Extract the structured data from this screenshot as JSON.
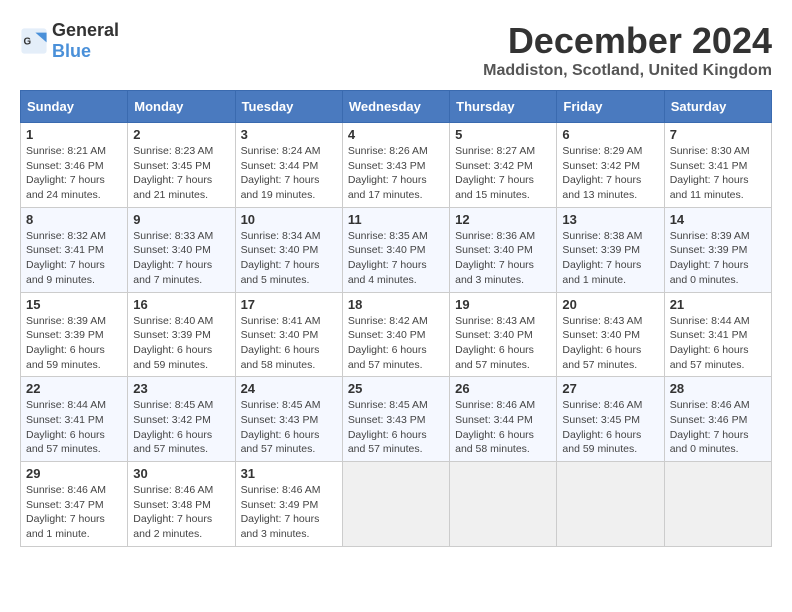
{
  "header": {
    "logo_general": "General",
    "logo_blue": "Blue",
    "month_title": "December 2024",
    "location": "Maddiston, Scotland, United Kingdom"
  },
  "days_of_week": [
    "Sunday",
    "Monday",
    "Tuesday",
    "Wednesday",
    "Thursday",
    "Friday",
    "Saturday"
  ],
  "weeks": [
    [
      {
        "day": "1",
        "sunrise": "Sunrise: 8:21 AM",
        "sunset": "Sunset: 3:46 PM",
        "daylight": "Daylight: 7 hours and 24 minutes."
      },
      {
        "day": "2",
        "sunrise": "Sunrise: 8:23 AM",
        "sunset": "Sunset: 3:45 PM",
        "daylight": "Daylight: 7 hours and 21 minutes."
      },
      {
        "day": "3",
        "sunrise": "Sunrise: 8:24 AM",
        "sunset": "Sunset: 3:44 PM",
        "daylight": "Daylight: 7 hours and 19 minutes."
      },
      {
        "day": "4",
        "sunrise": "Sunrise: 8:26 AM",
        "sunset": "Sunset: 3:43 PM",
        "daylight": "Daylight: 7 hours and 17 minutes."
      },
      {
        "day": "5",
        "sunrise": "Sunrise: 8:27 AM",
        "sunset": "Sunset: 3:42 PM",
        "daylight": "Daylight: 7 hours and 15 minutes."
      },
      {
        "day": "6",
        "sunrise": "Sunrise: 8:29 AM",
        "sunset": "Sunset: 3:42 PM",
        "daylight": "Daylight: 7 hours and 13 minutes."
      },
      {
        "day": "7",
        "sunrise": "Sunrise: 8:30 AM",
        "sunset": "Sunset: 3:41 PM",
        "daylight": "Daylight: 7 hours and 11 minutes."
      }
    ],
    [
      {
        "day": "8",
        "sunrise": "Sunrise: 8:32 AM",
        "sunset": "Sunset: 3:41 PM",
        "daylight": "Daylight: 7 hours and 9 minutes."
      },
      {
        "day": "9",
        "sunrise": "Sunrise: 8:33 AM",
        "sunset": "Sunset: 3:40 PM",
        "daylight": "Daylight: 7 hours and 7 minutes."
      },
      {
        "day": "10",
        "sunrise": "Sunrise: 8:34 AM",
        "sunset": "Sunset: 3:40 PM",
        "daylight": "Daylight: 7 hours and 5 minutes."
      },
      {
        "day": "11",
        "sunrise": "Sunrise: 8:35 AM",
        "sunset": "Sunset: 3:40 PM",
        "daylight": "Daylight: 7 hours and 4 minutes."
      },
      {
        "day": "12",
        "sunrise": "Sunrise: 8:36 AM",
        "sunset": "Sunset: 3:40 PM",
        "daylight": "Daylight: 7 hours and 3 minutes."
      },
      {
        "day": "13",
        "sunrise": "Sunrise: 8:38 AM",
        "sunset": "Sunset: 3:39 PM",
        "daylight": "Daylight: 7 hours and 1 minute."
      },
      {
        "day": "14",
        "sunrise": "Sunrise: 8:39 AM",
        "sunset": "Sunset: 3:39 PM",
        "daylight": "Daylight: 7 hours and 0 minutes."
      }
    ],
    [
      {
        "day": "15",
        "sunrise": "Sunrise: 8:39 AM",
        "sunset": "Sunset: 3:39 PM",
        "daylight": "Daylight: 6 hours and 59 minutes."
      },
      {
        "day": "16",
        "sunrise": "Sunrise: 8:40 AM",
        "sunset": "Sunset: 3:39 PM",
        "daylight": "Daylight: 6 hours and 59 minutes."
      },
      {
        "day": "17",
        "sunrise": "Sunrise: 8:41 AM",
        "sunset": "Sunset: 3:40 PM",
        "daylight": "Daylight: 6 hours and 58 minutes."
      },
      {
        "day": "18",
        "sunrise": "Sunrise: 8:42 AM",
        "sunset": "Sunset: 3:40 PM",
        "daylight": "Daylight: 6 hours and 57 minutes."
      },
      {
        "day": "19",
        "sunrise": "Sunrise: 8:43 AM",
        "sunset": "Sunset: 3:40 PM",
        "daylight": "Daylight: 6 hours and 57 minutes."
      },
      {
        "day": "20",
        "sunrise": "Sunrise: 8:43 AM",
        "sunset": "Sunset: 3:40 PM",
        "daylight": "Daylight: 6 hours and 57 minutes."
      },
      {
        "day": "21",
        "sunrise": "Sunrise: 8:44 AM",
        "sunset": "Sunset: 3:41 PM",
        "daylight": "Daylight: 6 hours and 57 minutes."
      }
    ],
    [
      {
        "day": "22",
        "sunrise": "Sunrise: 8:44 AM",
        "sunset": "Sunset: 3:41 PM",
        "daylight": "Daylight: 6 hours and 57 minutes."
      },
      {
        "day": "23",
        "sunrise": "Sunrise: 8:45 AM",
        "sunset": "Sunset: 3:42 PM",
        "daylight": "Daylight: 6 hours and 57 minutes."
      },
      {
        "day": "24",
        "sunrise": "Sunrise: 8:45 AM",
        "sunset": "Sunset: 3:43 PM",
        "daylight": "Daylight: 6 hours and 57 minutes."
      },
      {
        "day": "25",
        "sunrise": "Sunrise: 8:45 AM",
        "sunset": "Sunset: 3:43 PM",
        "daylight": "Daylight: 6 hours and 57 minutes."
      },
      {
        "day": "26",
        "sunrise": "Sunrise: 8:46 AM",
        "sunset": "Sunset: 3:44 PM",
        "daylight": "Daylight: 6 hours and 58 minutes."
      },
      {
        "day": "27",
        "sunrise": "Sunrise: 8:46 AM",
        "sunset": "Sunset: 3:45 PM",
        "daylight": "Daylight: 6 hours and 59 minutes."
      },
      {
        "day": "28",
        "sunrise": "Sunrise: 8:46 AM",
        "sunset": "Sunset: 3:46 PM",
        "daylight": "Daylight: 7 hours and 0 minutes."
      }
    ],
    [
      {
        "day": "29",
        "sunrise": "Sunrise: 8:46 AM",
        "sunset": "Sunset: 3:47 PM",
        "daylight": "Daylight: 7 hours and 1 minute."
      },
      {
        "day": "30",
        "sunrise": "Sunrise: 8:46 AM",
        "sunset": "Sunset: 3:48 PM",
        "daylight": "Daylight: 7 hours and 2 minutes."
      },
      {
        "day": "31",
        "sunrise": "Sunrise: 8:46 AM",
        "sunset": "Sunset: 3:49 PM",
        "daylight": "Daylight: 7 hours and 3 minutes."
      },
      null,
      null,
      null,
      null
    ]
  ]
}
